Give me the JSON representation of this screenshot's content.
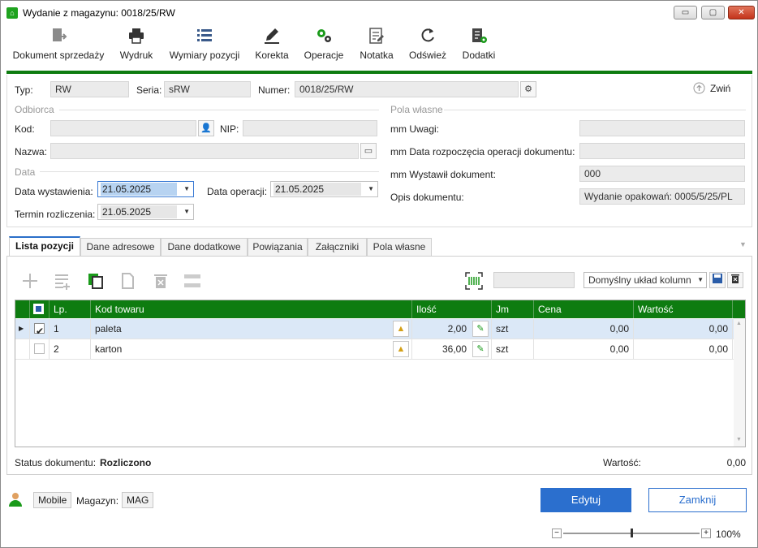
{
  "window": {
    "title": "Wydanie z magazynu: 0018/25/RW",
    "controls": {
      "minimize": "▭",
      "maximize": "▢",
      "close": "✕"
    }
  },
  "toolbar": {
    "items": [
      {
        "label": "Dokument sprzedaży",
        "icon": "document-arrow-icon"
      },
      {
        "label": "Wydruk",
        "icon": "printer-icon"
      },
      {
        "label": "Wymiary pozycji",
        "icon": "list-icon"
      },
      {
        "label": "Korekta",
        "icon": "pen-icon"
      },
      {
        "label": "Operacje",
        "icon": "gears-icon"
      },
      {
        "label": "Notatka",
        "icon": "note-icon"
      },
      {
        "label": "Odśwież",
        "icon": "refresh-icon"
      },
      {
        "label": "Dodatki",
        "icon": "addons-icon"
      }
    ],
    "accent_color": "#0e7c10"
  },
  "header": {
    "typ_label": "Typ:",
    "typ_value": "RW",
    "seria_label": "Seria:",
    "seria_value": "sRW",
    "numer_label": "Numer:",
    "numer_value": "0018/25/RW",
    "collapse_label": "Zwiń"
  },
  "odbiorca": {
    "section": "Odbiorca",
    "kod_label": "Kod:",
    "kod_value": "",
    "nip_label": "NIP:",
    "nip_value": "",
    "nazwa_label": "Nazwa:",
    "nazwa_value": ""
  },
  "data_section": {
    "section": "Data",
    "wystawienia_label": "Data wystawienia:",
    "wystawienia_value": "21.05.2025",
    "operacji_label": "Data operacji:",
    "operacji_value": "21.05.2025",
    "termin_label": "Termin rozliczenia:",
    "termin_value": "21.05.2025"
  },
  "pola_wlasne": {
    "section": "Pola własne",
    "uwagi_label": "mm Uwagi:",
    "uwagi_value": "",
    "data_rozp_label": "mm Data rozpoczęcia operacji dokumentu:",
    "data_rozp_value": "",
    "wystawil_label": "mm Wystawił dokument:",
    "wystawil_value": "000",
    "opis_label": "Opis dokumentu:",
    "opis_value": "Wydanie opakowań: 0005/5/25/PL"
  },
  "tabs": [
    "Lista pozycji",
    "Dane adresowe",
    "Dane dodatkowe",
    "Powiązania",
    "Załączniki",
    "Pola własne"
  ],
  "grid_toolbar": {
    "search_value": "",
    "layout_value": "Domyślny układ kolumn"
  },
  "grid": {
    "columns": [
      "Lp.",
      "Kod towaru",
      "Ilość",
      "Jm",
      "Cena",
      "Wartość"
    ],
    "rows": [
      {
        "lp": "1",
        "kod": "paleta",
        "ilosc": "2,00",
        "jm": "szt",
        "cena": "0,00",
        "wartosc": "0,00",
        "checked": true
      },
      {
        "lp": "2",
        "kod": "karton",
        "ilosc": "36,00",
        "jm": "szt",
        "cena": "0,00",
        "wartosc": "0,00",
        "checked": false
      }
    ]
  },
  "status": {
    "label": "Status dokumentu:",
    "value": "Rozliczono",
    "wartosc_label": "Wartość:",
    "wartosc_value": "0,00"
  },
  "footer": {
    "mobile_label": "Mobile",
    "magazyn_label": "Magazyn:",
    "magazyn_value": "MAG",
    "edit_button": "Edytuj",
    "close_button": "Zamknij",
    "zoom_minus": "−",
    "zoom_plus": "+",
    "zoom_value": "100%"
  }
}
